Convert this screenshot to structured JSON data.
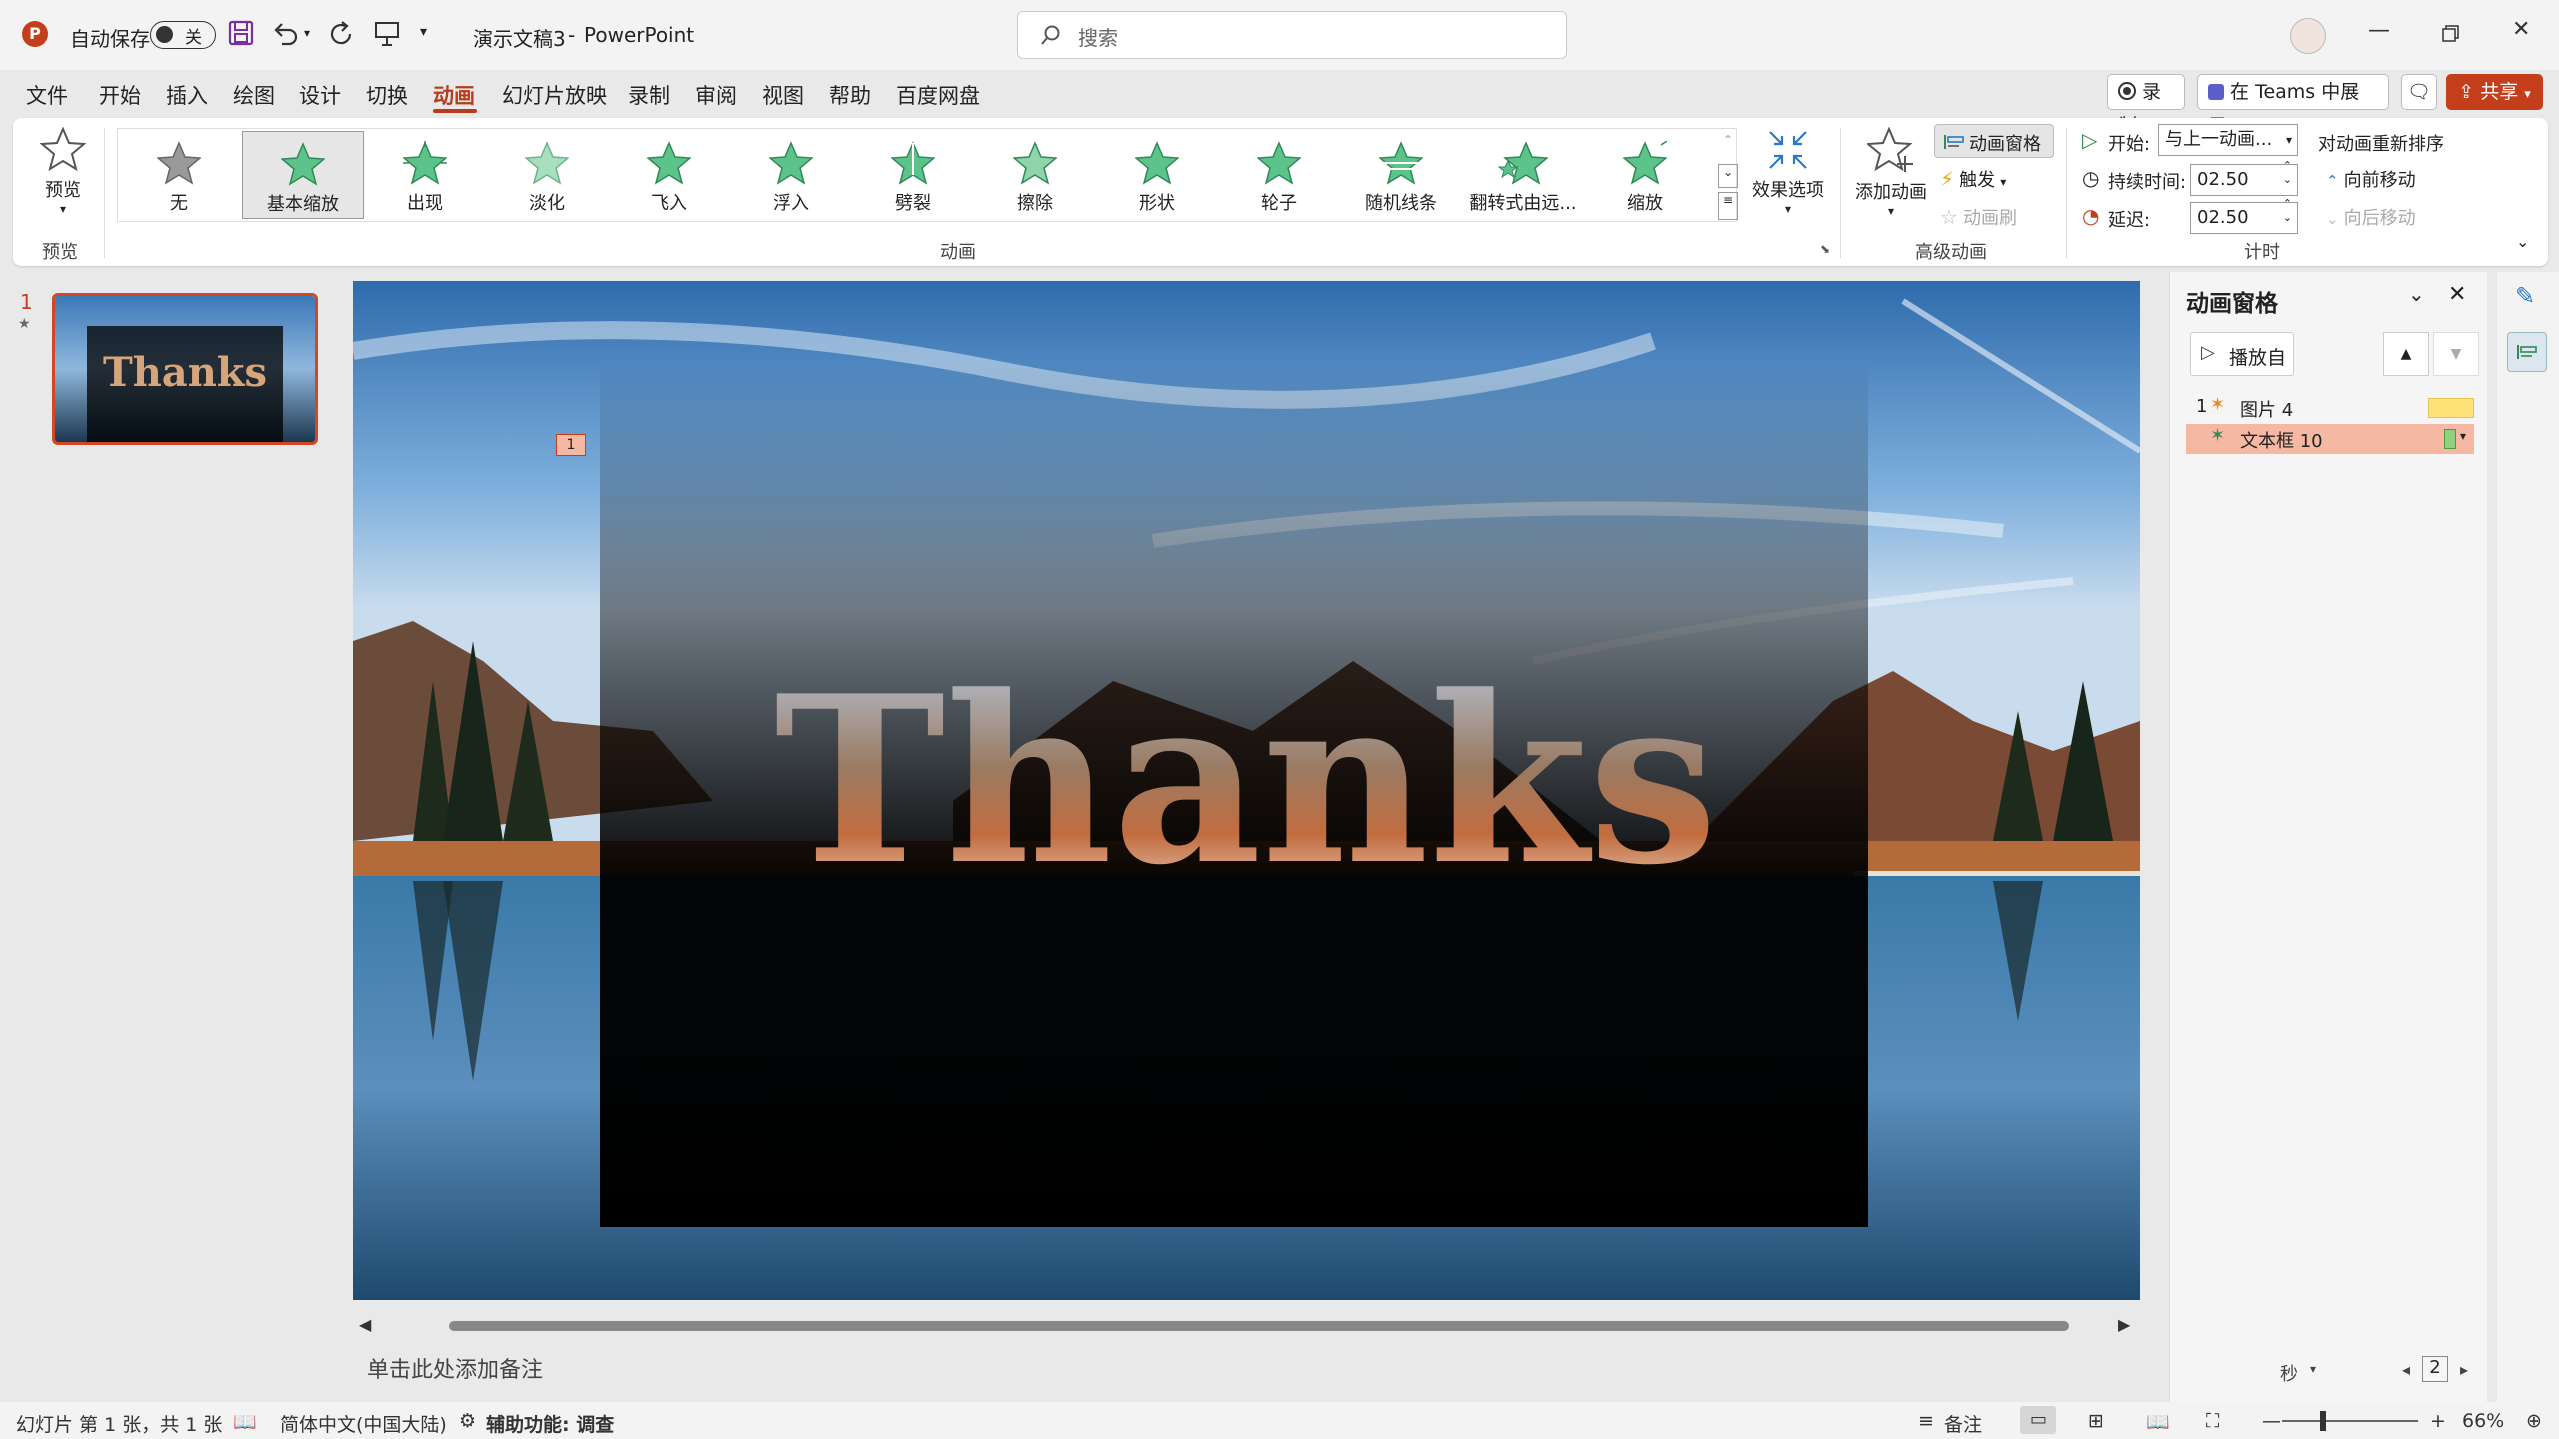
{
  "titlebar": {
    "app_icon": "P",
    "autosave_label": "自动保存",
    "autosave_state": "关",
    "doc_title": "演示文稿3",
    "separator": "-",
    "app_name": "PowerPoint",
    "search_placeholder": "搜索"
  },
  "menu": {
    "items": [
      "文件",
      "开始",
      "插入",
      "绘图",
      "设计",
      "切换",
      "动画",
      "幻灯片放映",
      "录制",
      "审阅",
      "视图",
      "帮助",
      "百度网盘"
    ],
    "active": "动画",
    "record_label": "录制",
    "teams_label": "在 Teams 中展示",
    "share_label": "共享"
  },
  "ribbon": {
    "preview_label": "预览",
    "preview_group": "预览",
    "animations": [
      "无",
      "基本缩放",
      "出现",
      "淡化",
      "飞入",
      "浮入",
      "劈裂",
      "擦除",
      "形状",
      "轮子",
      "随机线条",
      "翻转式由远...",
      "缩放"
    ],
    "selected_animation": "基本缩放",
    "effect_options_label": "效果选项",
    "animation_group": "动画",
    "add_animation_label": "添加动画",
    "animation_pane_label": "动画窗格",
    "trigger_label": "触发",
    "animation_painter_label": "动画刷",
    "advanced_group": "高级动画",
    "start_label": "开始:",
    "start_value": "与上一动画...",
    "duration_label": "持续时间:",
    "duration_value": "02.50",
    "delay_label": "延迟:",
    "delay_value": "02.50",
    "reorder_label": "对动画重新排序",
    "move_earlier_label": "向前移动",
    "move_later_label": "向后移动",
    "timing_group": "计时"
  },
  "slides": {
    "number": "1",
    "thumb_text": "Thanks"
  },
  "slide": {
    "title": "Thanks",
    "anim_tag": "1"
  },
  "notes_placeholder": "单击此处添加备注",
  "anim_pane": {
    "title": "动画窗格",
    "play_from_label": "播放自",
    "items": [
      {
        "index": "1",
        "name": "图片 4"
      },
      {
        "index": "",
        "name": "文本框 10"
      }
    ],
    "time_unit": "秒",
    "zoom_value": "2"
  },
  "statusbar": {
    "slide_info": "幻灯片 第 1 张，共 1 张",
    "language": "简体中文(中国大陆)",
    "accessibility": "辅助功能: 调查",
    "notes_label": "备注",
    "zoom": "66%"
  },
  "colors": {
    "accent": "#b83b1b",
    "share": "#c43e1c",
    "star_green": "#5cc48a",
    "selected_row": "#f5b8a2",
    "timeline_yellow": "#ffe17a",
    "timeline_green": "#8fd17f"
  }
}
